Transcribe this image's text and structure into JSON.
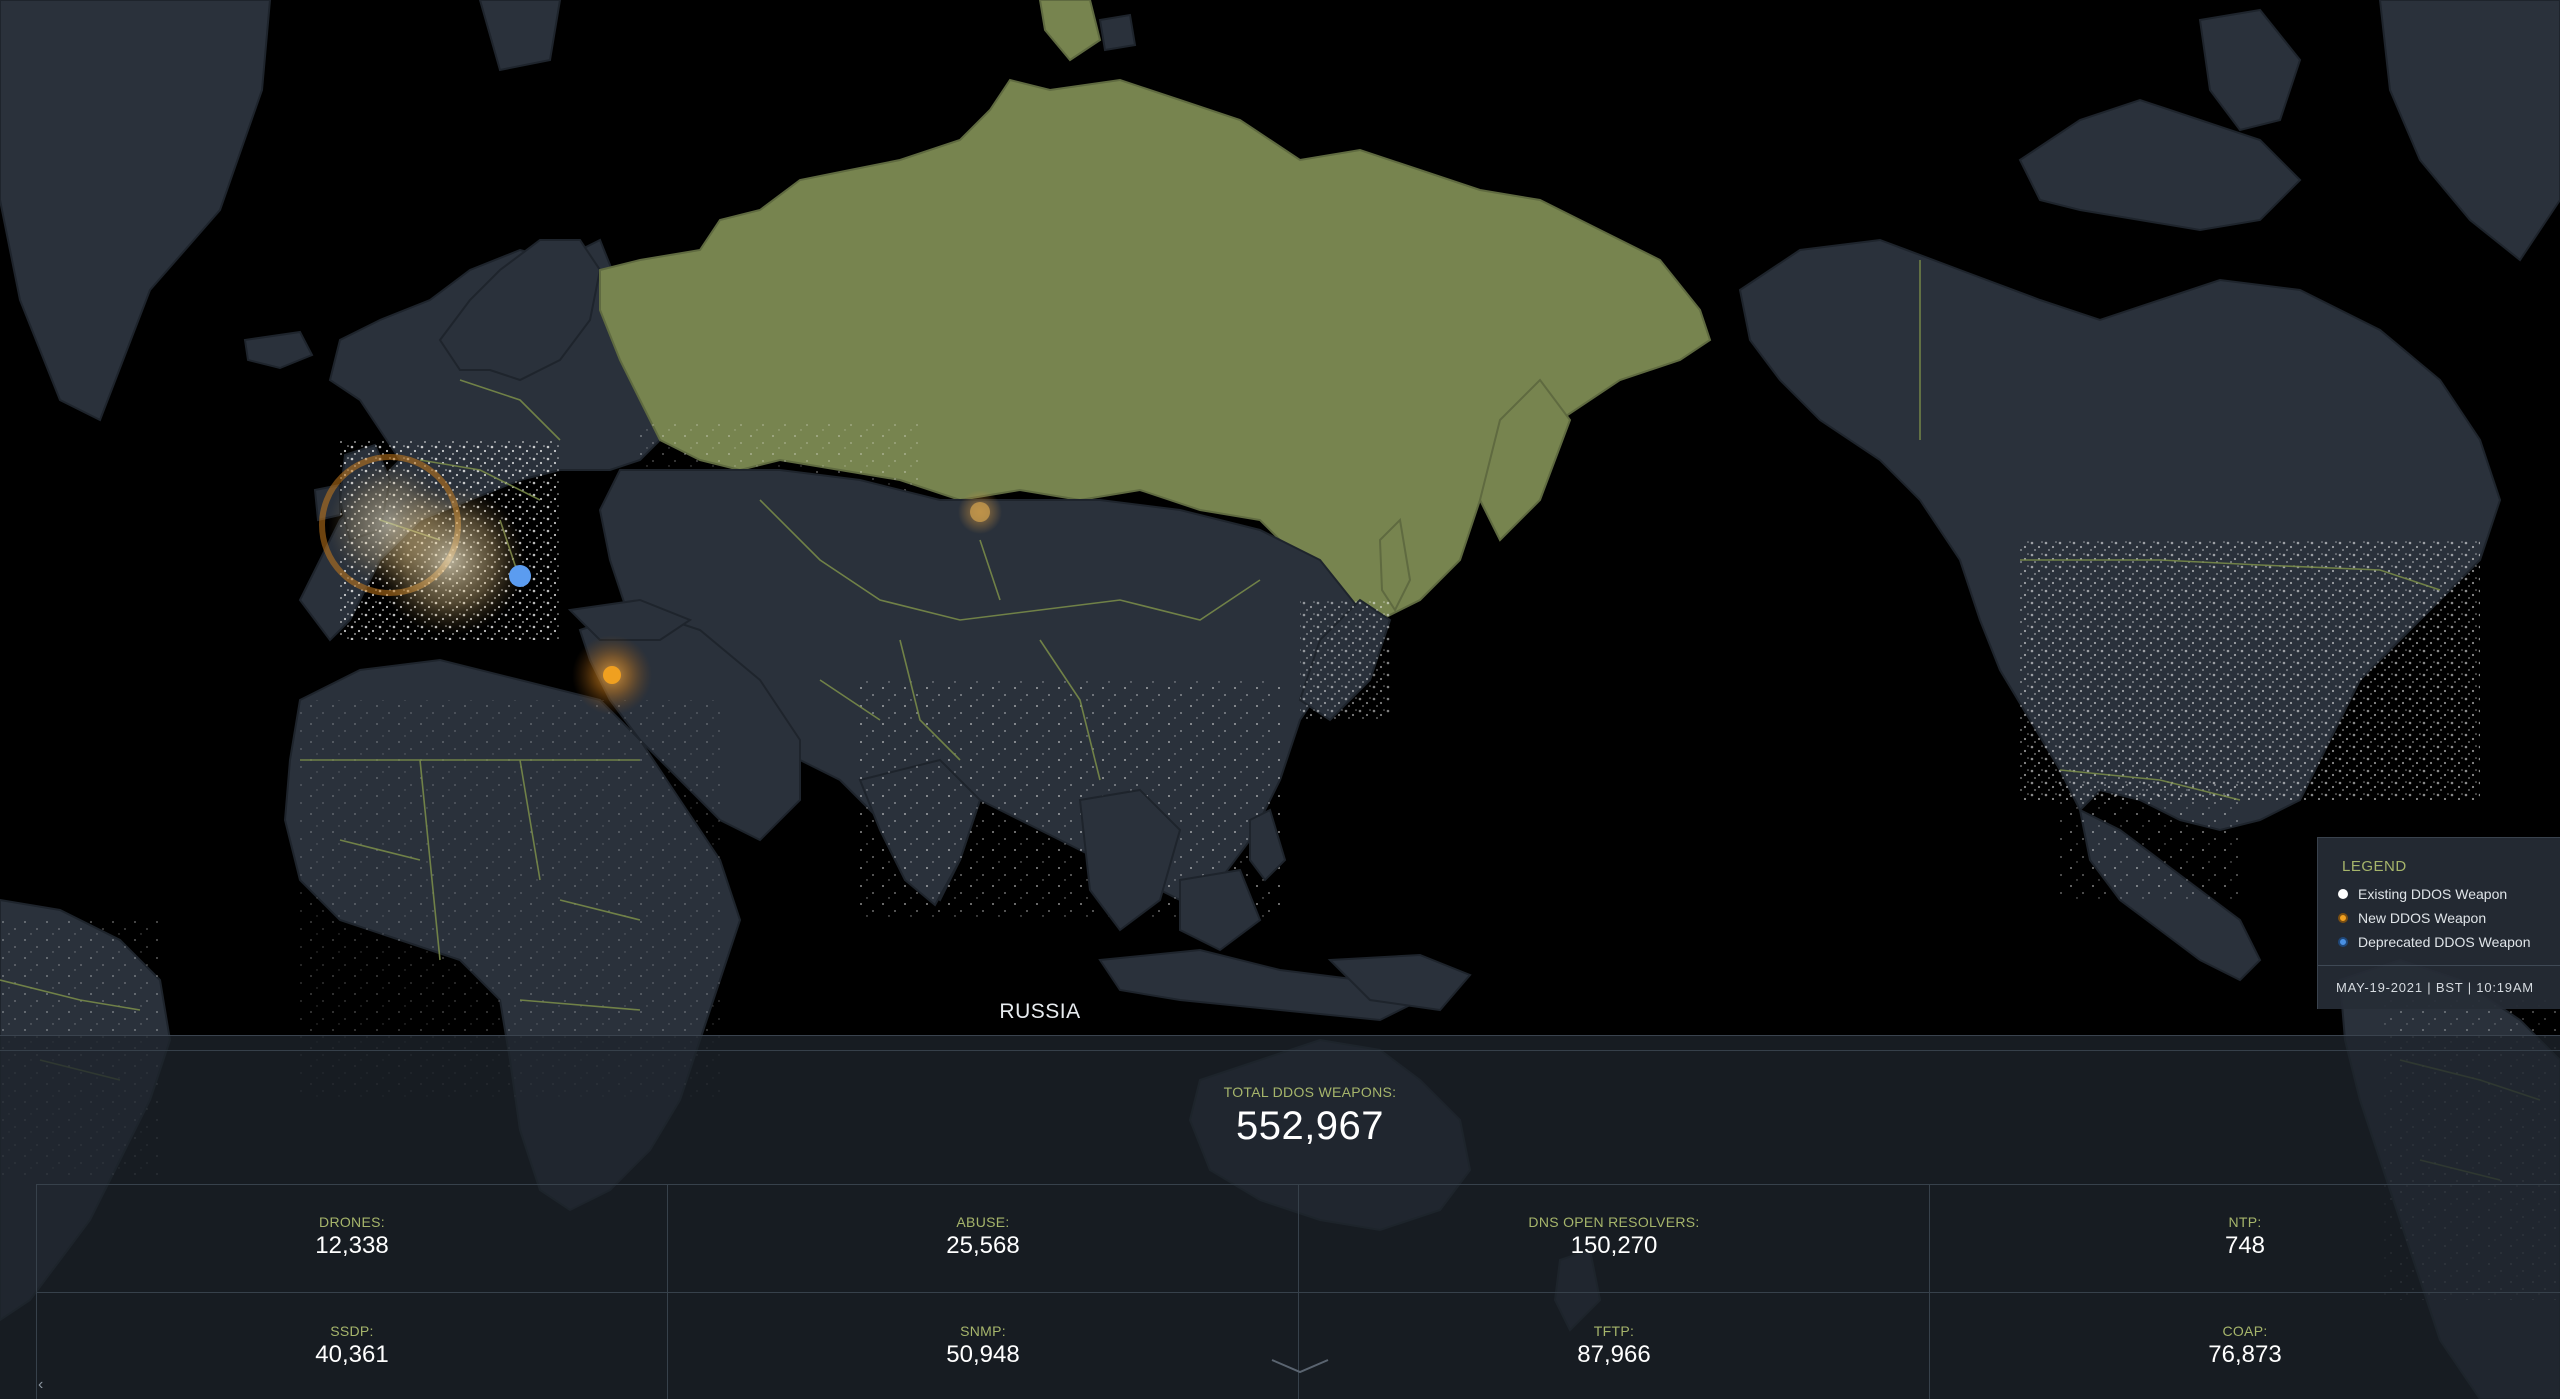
{
  "map": {
    "country_label": "RUSSIA",
    "colors": {
      "ocean": "#000000",
      "land": "#2a313b",
      "highlight_country": "#77844f",
      "border": "#7d8f4a"
    }
  },
  "legend": {
    "title": "LEGEND",
    "items": [
      {
        "label": "Existing DDOS Weapon",
        "color": "#ffffff",
        "icon": "white-dot-icon"
      },
      {
        "label": "New DDOS Weapon",
        "color": "#f0a020",
        "icon": "orange-ring-dot-icon"
      },
      {
        "label": "Deprecated DDOS Weapon",
        "color": "#4a90e2",
        "icon": "blue-ring-dot-icon"
      }
    ],
    "timestamp": "MAY-19-2021 | BST | 10:19AM"
  },
  "stats": {
    "total_label": "TOTAL DDOS WEAPONS:",
    "total_value": "552,967",
    "items": [
      {
        "label": "DRONES:",
        "value": "12,338"
      },
      {
        "label": "ABUSE:",
        "value": "25,568"
      },
      {
        "label": "DNS OPEN RESOLVERS:",
        "value": "150,270"
      },
      {
        "label": "NTP:",
        "value": "748"
      },
      {
        "label": "SSDP:",
        "value": "40,361"
      },
      {
        "label": "SNMP:",
        "value": "50,948"
      },
      {
        "label": "TFTP:",
        "value": "87,966"
      },
      {
        "label": "COAP:",
        "value": "76,873"
      }
    ]
  },
  "icons": {
    "collapse": "chevron-down-icon",
    "scroll_left": "chevron-left-icon"
  }
}
